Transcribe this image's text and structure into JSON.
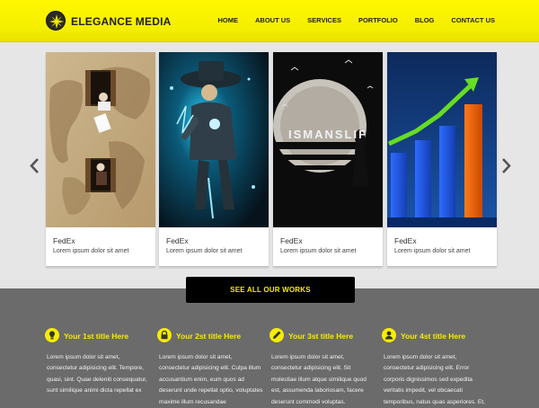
{
  "header": {
    "brand": "ELEGANCE MEDIA",
    "nav": [
      "HOME",
      "ABOUT US",
      "SERVICES",
      "PORTFOLIO",
      "BLOG",
      "CONTACT US"
    ],
    "accent": "#fff700"
  },
  "slider": {
    "cards": [
      {
        "title": "FedEx",
        "text": "Lorem ipsum dolor sit amet"
      },
      {
        "title": "FedEx",
        "text": "Lorem ipsum dolor sit amet"
      },
      {
        "title": "FedEx",
        "text": "Lorem ipsum dolor sit amet"
      },
      {
        "title": "FedEx",
        "text": "Lorem ipsum dolor sit amet"
      }
    ],
    "poster_text": "ISMANSLIF"
  },
  "cta": {
    "label": "SEE ALL OUR WORKS"
  },
  "features": [
    {
      "icon": "lightbulb-icon",
      "title": "Your 1st title Here",
      "body": "Lorem ipsum dolor sit amet, consectetur adipisicing elit. Tempore, quasi, sint. Quae deleniti consequatur, sunt similique animi dicta repellat ex"
    },
    {
      "icon": "lock-icon",
      "title": "Your 2st title Here",
      "body": "Lorem ipsum dolor sit amet, consectetur adipisicing elit. Culpa illum accusantium enim, eum quos ad deserunt unde repellat optio, voluptates maxime illum recusandae"
    },
    {
      "icon": "pencil-icon",
      "title": "Your 3st title Here",
      "body": "Lorem ipsum dolor sit amet, consectetur adipisicing elit. Sit molestiae illum atque similique quod est, assumenda laboriosam, facere deserunt commodi voluptas. Quibusdam"
    },
    {
      "icon": "user-icon",
      "title": "Your 4st title Here",
      "body": "Lorem ipsum dolor sit amet, consectetur adipisicing elit. Error corporis dignissimos sed expedita veritatis impedit, vel obcaecati temporibus, natus quas asperiores. Et, excepturi, quam. Accusantium, esse."
    }
  ]
}
